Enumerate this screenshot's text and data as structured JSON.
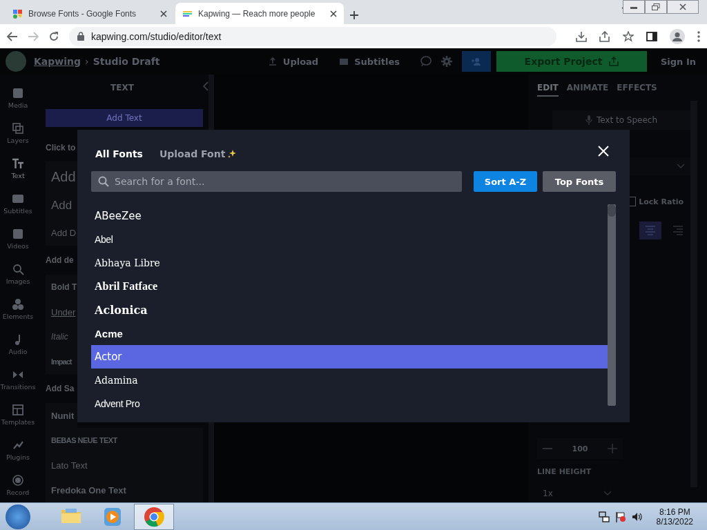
{
  "browser": {
    "tabs": [
      {
        "title": "Browse Fonts - Google Fonts",
        "selected": false
      },
      {
        "title": "Kapwing — Reach more people",
        "selected": true
      }
    ],
    "url": "kapwing.com/studio/editor/text"
  },
  "header": {
    "brand": "Kapwing",
    "separator": "›",
    "project": "Studio Draft",
    "actions": [
      "Upload",
      "Subtitles"
    ],
    "export": "Export Project",
    "sign_in": "Sign In"
  },
  "rail": [
    {
      "label": "Media",
      "selected": false
    },
    {
      "label": "Layers",
      "selected": false
    },
    {
      "label": "Text",
      "selected": true
    },
    {
      "label": "Subtitles",
      "selected": false
    },
    {
      "label": "Videos",
      "selected": false
    },
    {
      "label": "Images",
      "selected": false
    },
    {
      "label": "Elements",
      "selected": false
    },
    {
      "label": "Audio",
      "selected": false
    },
    {
      "label": "Transitions",
      "selected": false
    },
    {
      "label": "Templates",
      "selected": false
    },
    {
      "label": "Plugins",
      "selected": false
    },
    {
      "label": "Record",
      "selected": false
    }
  ],
  "text_panel": {
    "title": "TEXT",
    "add_button": "Add Text",
    "items": [
      {
        "text": "Click to",
        "kind": "hint"
      },
      {
        "text": "Add",
        "kind": "heading"
      },
      {
        "text": "Add",
        "kind": "subheading"
      },
      {
        "text": "Add D",
        "kind": "body"
      },
      {
        "text": "Add de",
        "kind": "section"
      },
      {
        "text": "Bold T",
        "kind": "bold"
      },
      {
        "text": "Under",
        "kind": "underline"
      },
      {
        "text": "Italic",
        "kind": "italic"
      },
      {
        "text": "Impact",
        "kind": "impact"
      },
      {
        "text": "Add Sa",
        "kind": "section"
      },
      {
        "text": "Nunit",
        "kind": "nunito"
      },
      {
        "text": "BEBAS NEUE TEXT",
        "kind": "bebas"
      },
      {
        "text": "Lato Text",
        "kind": "lato"
      },
      {
        "text": "Fredoka One Text",
        "kind": "fredoka"
      }
    ]
  },
  "inspector": {
    "tabs": [
      {
        "label": "EDIT",
        "selected": true
      },
      {
        "label": "ANIMATE",
        "selected": false
      },
      {
        "label": "EFFECTS",
        "selected": false
      }
    ],
    "tts": "Text to Speech",
    "lock_ratio": {
      "label": "Lock Ratio",
      "checked": false
    },
    "align": [
      {
        "selected": true
      },
      {
        "selected": false
      }
    ],
    "size": "100",
    "line_height_label": "LINE HEIGHT",
    "line_height": "1x"
  },
  "modal": {
    "tabs": [
      {
        "label": "All Fonts",
        "selected": true
      },
      {
        "label": "Upload Font",
        "selected": false
      }
    ],
    "search": {
      "placeholder": "Search for a font..."
    },
    "sort_buttons": [
      {
        "label": "Sort A-Z",
        "selected": true
      },
      {
        "label": "Top Fonts",
        "selected": false
      }
    ],
    "fonts": [
      {
        "name": "ABeeZee",
        "kind": "sans",
        "selected": false
      },
      {
        "name": "Abel",
        "kind": "condensed",
        "selected": false
      },
      {
        "name": "Abhaya Libre",
        "kind": "serif",
        "selected": false
      },
      {
        "name": "Abril Fatface",
        "kind": "fatface",
        "selected": false
      },
      {
        "name": "Aclonica",
        "kind": "rounded",
        "selected": false
      },
      {
        "name": "Acme",
        "kind": "heavy",
        "selected": false
      },
      {
        "name": "Actor",
        "kind": "sans",
        "selected": true
      },
      {
        "name": "Adamina",
        "kind": "serif",
        "selected": false
      },
      {
        "name": "Advent Pro",
        "kind": "condensed",
        "selected": false
      }
    ]
  },
  "taskbar": {
    "apps": [
      {
        "kind": "folder",
        "selected": false
      },
      {
        "kind": "media",
        "selected": false
      },
      {
        "kind": "chrome",
        "selected": true
      }
    ],
    "time": "8:16 PM",
    "date": "8/13/2022"
  }
}
